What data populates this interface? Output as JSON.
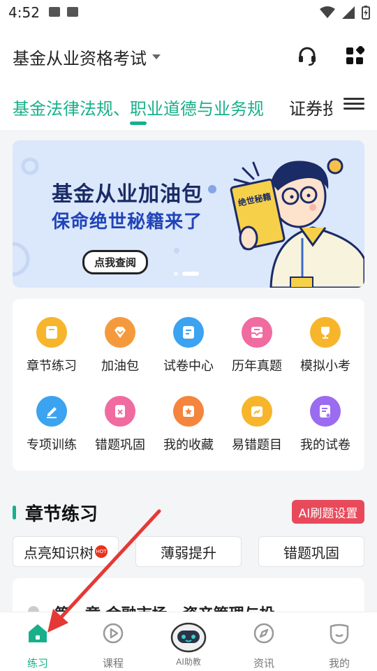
{
  "status_bar": {
    "time": "4:52"
  },
  "header": {
    "title": "基金从业资格考试"
  },
  "tabs": {
    "active": "基金法律法规、职业道德与业务规",
    "next": "证券投"
  },
  "banner": {
    "title": "基金从业加油包",
    "subtitle": "保命绝世秘籍来了",
    "button": "点我查阅",
    "book_text": "绝世秘籍"
  },
  "grid": {
    "items": [
      {
        "label": "章节练习",
        "icon": "notebook-icon",
        "color": "#f7b52c"
      },
      {
        "label": "加油包",
        "icon": "heart-gem-icon",
        "color": "#f59a3c"
      },
      {
        "label": "试卷中心",
        "icon": "paper-icon",
        "color": "#3ba3f0"
      },
      {
        "label": "历年真题",
        "icon": "inbox-icon",
        "color": "#f06ba0"
      },
      {
        "label": "模拟小考",
        "icon": "trophy-icon",
        "color": "#f7b52c"
      },
      {
        "label": "专项训练",
        "icon": "pen-icon",
        "color": "#3ba3f0"
      },
      {
        "label": "错题巩固",
        "icon": "wrong-book-icon",
        "color": "#f06ba0"
      },
      {
        "label": "我的收藏",
        "icon": "star-box-icon",
        "color": "#f5843c"
      },
      {
        "label": "易错题目",
        "icon": "chart-calendar-icon",
        "color": "#f7b52c"
      },
      {
        "label": "我的试卷",
        "icon": "my-paper-icon",
        "color": "#9b6bf0"
      }
    ]
  },
  "section": {
    "title": "章节练习",
    "ai_button": "AI刷题设置"
  },
  "chips": [
    {
      "label": "点亮知识树",
      "badge": "HOT"
    },
    {
      "label": "薄弱提升"
    },
    {
      "label": "错题巩固"
    }
  ],
  "card": {
    "text": "第一章  金融市场、资产管理与投"
  },
  "nav": [
    {
      "label": "练习",
      "icon": "home-icon"
    },
    {
      "label": "课程",
      "icon": "play-icon"
    },
    {
      "label": "AI助教",
      "icon": "robot-icon"
    },
    {
      "label": "资讯",
      "icon": "compass-icon"
    },
    {
      "label": "我的",
      "icon": "profile-icon"
    }
  ],
  "colors": {
    "accent": "#18b08a",
    "ai_button": "#e84a5b",
    "arrow": "#e53935"
  }
}
